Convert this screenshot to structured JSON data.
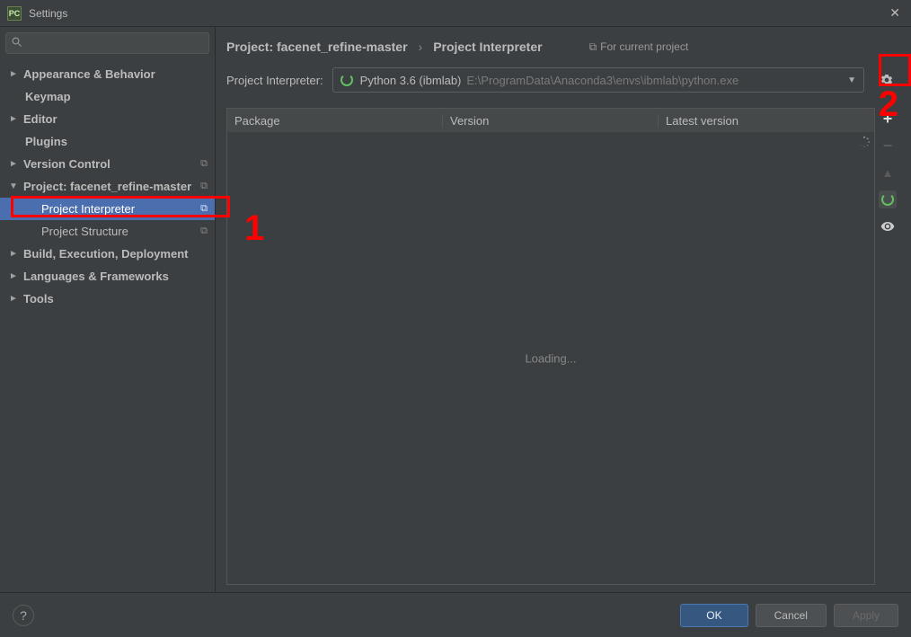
{
  "title": "Settings",
  "app_icon": "PC",
  "sidebar": {
    "search_placeholder": "",
    "items": [
      {
        "label": "Appearance & Behavior",
        "arrow": "►",
        "indent": 0,
        "bold": true
      },
      {
        "label": "Keymap",
        "arrow": "",
        "indent": 1,
        "bold": true
      },
      {
        "label": "Editor",
        "arrow": "►",
        "indent": 0,
        "bold": true
      },
      {
        "label": "Plugins",
        "arrow": "",
        "indent": 1,
        "bold": true
      },
      {
        "label": "Version Control",
        "arrow": "►",
        "indent": 0,
        "bold": true,
        "dup": true
      },
      {
        "label": "Project: facenet_refine-master",
        "arrow": "▼",
        "indent": 0,
        "bold": true,
        "dup": true
      },
      {
        "label": "Project Interpreter",
        "arrow": "",
        "indent": 2,
        "bold": false,
        "dup": true,
        "selected": true
      },
      {
        "label": "Project Structure",
        "arrow": "",
        "indent": 2,
        "bold": false,
        "dup": true
      },
      {
        "label": "Build, Execution, Deployment",
        "arrow": "►",
        "indent": 0,
        "bold": true
      },
      {
        "label": "Languages & Frameworks",
        "arrow": "►",
        "indent": 0,
        "bold": true
      },
      {
        "label": "Tools",
        "arrow": "►",
        "indent": 0,
        "bold": true
      }
    ]
  },
  "breadcrumb": {
    "root": "Project: facenet_refine-master",
    "sep": "›",
    "current": "Project Interpreter",
    "for_current": "For current project"
  },
  "interpreter": {
    "label": "Project Interpreter:",
    "name": "Python 3.6 (ibmlab)",
    "path": "E:\\ProgramData\\Anaconda3\\envs\\ibmlab\\python.exe"
  },
  "table": {
    "headers": [
      "Package",
      "Version",
      "Latest version"
    ],
    "loading": "Loading..."
  },
  "footer": {
    "ok": "OK",
    "cancel": "Cancel",
    "apply": "Apply"
  },
  "annotations": {
    "one": "1",
    "two": "2"
  }
}
